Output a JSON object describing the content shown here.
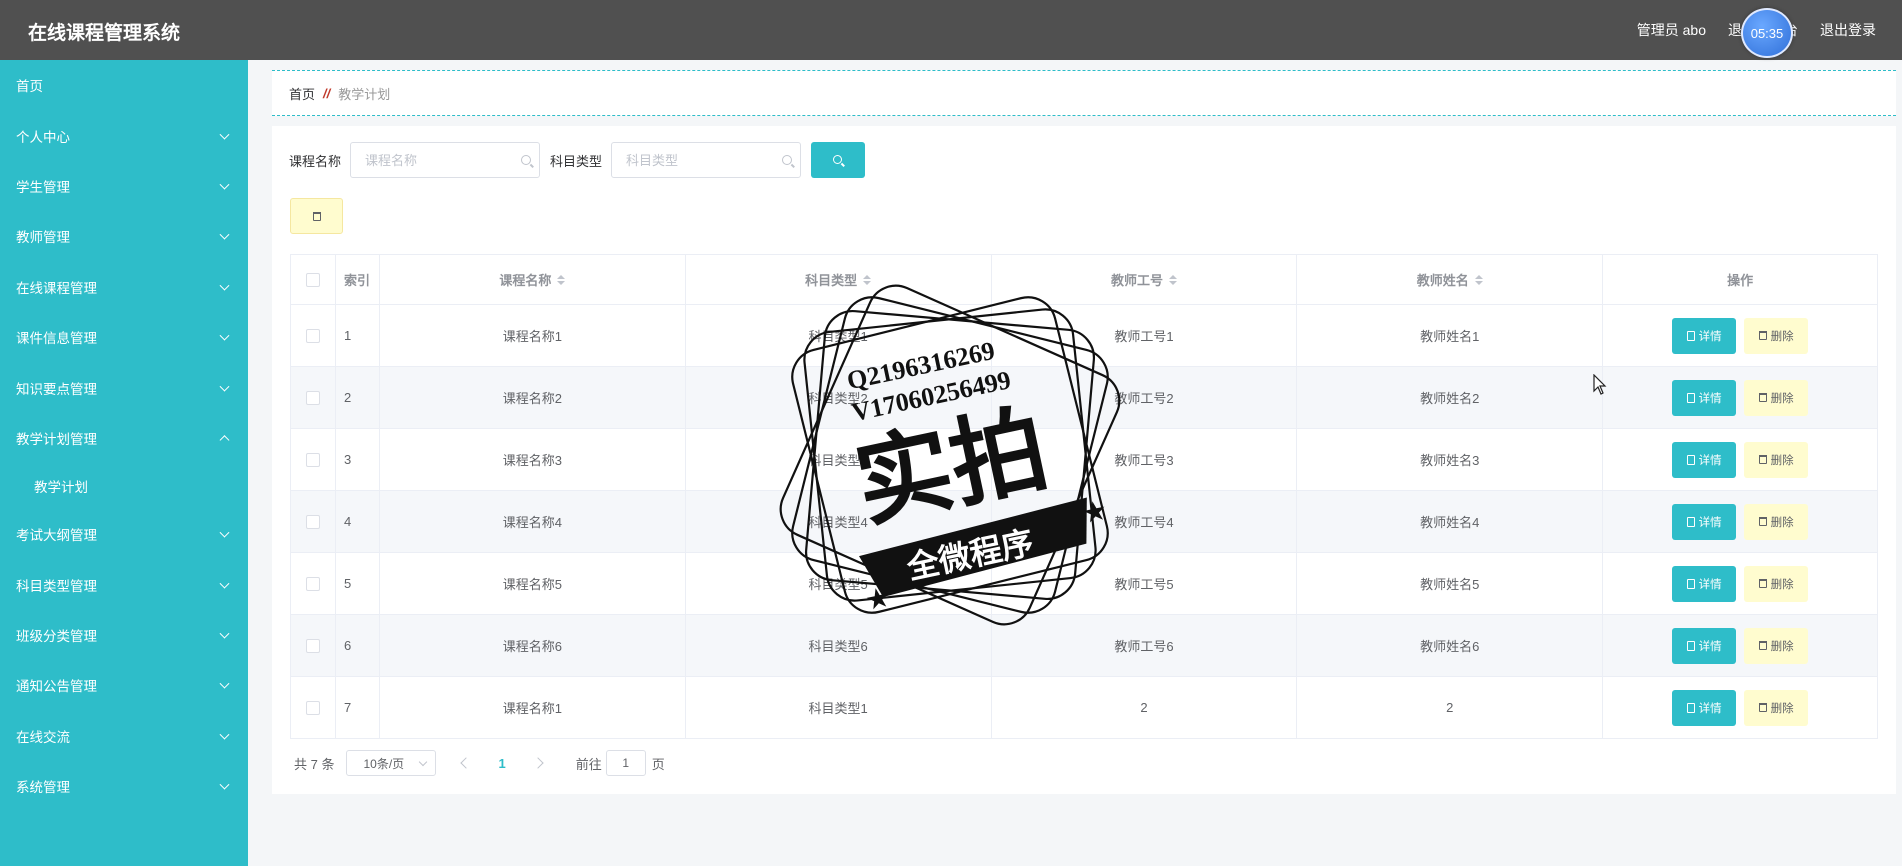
{
  "app": {
    "title": "在线课程管理系统"
  },
  "topbar": {
    "user_label": "管理员 abo",
    "back_label": "退出到前台",
    "logout_label": "退出登录",
    "clock": "05:35"
  },
  "sidebar": {
    "items": [
      {
        "label": "首页",
        "expandable": false
      },
      {
        "label": "个人中心",
        "expandable": true
      },
      {
        "label": "学生管理",
        "expandable": true
      },
      {
        "label": "教师管理",
        "expandable": true
      },
      {
        "label": "在线课程管理",
        "expandable": true
      },
      {
        "label": "课件信息管理",
        "expandable": true
      },
      {
        "label": "知识要点管理",
        "expandable": true
      },
      {
        "label": "教学计划管理",
        "expandable": true,
        "expanded": true,
        "children": [
          "教学计划"
        ]
      },
      {
        "label": "考试大纲管理",
        "expandable": true
      },
      {
        "label": "科目类型管理",
        "expandable": true
      },
      {
        "label": "班级分类管理",
        "expandable": true
      },
      {
        "label": "通知公告管理",
        "expandable": true
      },
      {
        "label": "在线交流",
        "expandable": true
      },
      {
        "label": "系统管理",
        "expandable": true
      }
    ]
  },
  "breadcrumb": {
    "home": "首页",
    "separator": "//",
    "current": "教学计划"
  },
  "search": {
    "course_label": "课程名称",
    "course_placeholder": "课程名称",
    "type_label": "科目类型",
    "type_placeholder": "科目类型"
  },
  "table": {
    "headers": {
      "index": "索引",
      "course_name": "课程名称",
      "subject_type": "科目类型",
      "teacher_no": "教师工号",
      "teacher_name": "教师姓名",
      "actions": "操作"
    },
    "detail_label": "详情",
    "delete_label": "删除",
    "rows": [
      {
        "index": "1",
        "course_name": "课程名称1",
        "subject_type": "科目类型1",
        "teacher_no": "教师工号1",
        "teacher_name": "教师姓名1"
      },
      {
        "index": "2",
        "course_name": "课程名称2",
        "subject_type": "科目类型2",
        "teacher_no": "教师工号2",
        "teacher_name": "教师姓名2"
      },
      {
        "index": "3",
        "course_name": "课程名称3",
        "subject_type": "科目类型3",
        "teacher_no": "教师工号3",
        "teacher_name": "教师姓名3"
      },
      {
        "index": "4",
        "course_name": "课程名称4",
        "subject_type": "科目类型4",
        "teacher_no": "教师工号4",
        "teacher_name": "教师姓名4"
      },
      {
        "index": "5",
        "course_name": "课程名称5",
        "subject_type": "科目类型5",
        "teacher_no": "教师工号5",
        "teacher_name": "教师姓名5"
      },
      {
        "index": "6",
        "course_name": "课程名称6",
        "subject_type": "科目类型6",
        "teacher_no": "教师工号6",
        "teacher_name": "教师姓名6"
      },
      {
        "index": "7",
        "course_name": "课程名称1",
        "subject_type": "科目类型1",
        "teacher_no": "2",
        "teacher_name": "2"
      }
    ]
  },
  "pagination": {
    "total": "共 7 条",
    "page_size": "10条/页",
    "current_page": "1",
    "goto_prefix": "前往",
    "goto_value": "1",
    "goto_suffix": "页"
  },
  "watermark": {
    "line1": "Q2196316269",
    "line2": "V17060256499",
    "main": "实拍",
    "banner": "全微程序"
  },
  "colors": {
    "accent": "#2ebdc9",
    "topbar": "#505050",
    "delete_bg": "#fffccf"
  }
}
